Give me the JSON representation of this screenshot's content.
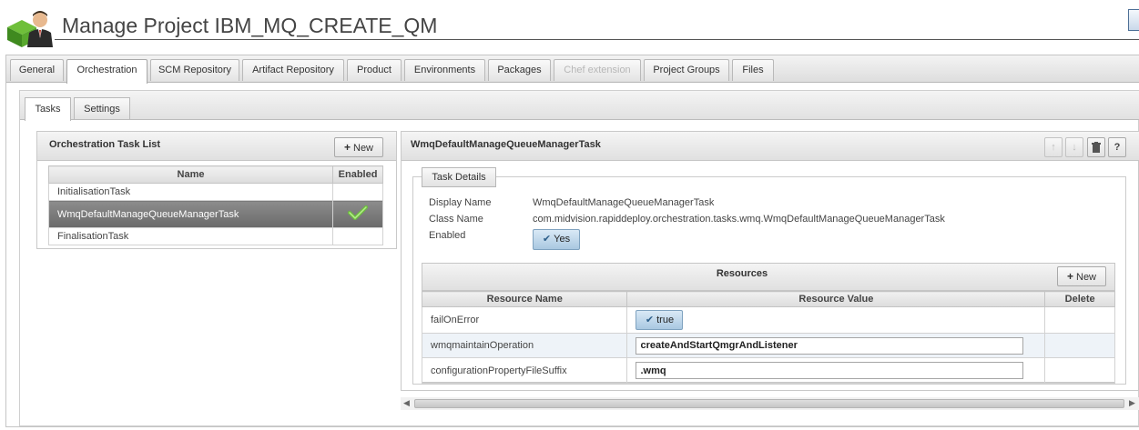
{
  "header": {
    "title": "Manage Project IBM_MQ_CREATE_QM"
  },
  "main_tabs": [
    {
      "label": "General"
    },
    {
      "label": "Orchestration"
    },
    {
      "label": "SCM Repository"
    },
    {
      "label": "Artifact Repository"
    },
    {
      "label": "Product"
    },
    {
      "label": "Environments"
    },
    {
      "label": "Packages"
    },
    {
      "label": "Chef extension"
    },
    {
      "label": "Project Groups"
    },
    {
      "label": "Files"
    }
  ],
  "sub_tabs": [
    {
      "label": "Tasks"
    },
    {
      "label": "Settings"
    }
  ],
  "task_list": {
    "title": "Orchestration Task List",
    "new_label": "New",
    "columns": [
      "Name",
      "Enabled"
    ],
    "rows": [
      {
        "name": "InitialisationTask"
      },
      {
        "name": "WmqDefaultManageQueueManagerTask"
      },
      {
        "name": "FinalisationTask"
      }
    ]
  },
  "detail": {
    "title": "WmqDefaultManageQueueManagerTask",
    "section_label": "Task Details",
    "display_name_label": "Display Name",
    "display_name_value": "WmqDefaultManageQueueManagerTask",
    "class_name_label": "Class Name",
    "class_name_value": "com.midvision.rapiddeploy.orchestration.tasks.wmq.WmqDefaultManageQueueManagerTask",
    "enabled_label": "Enabled",
    "enabled_value": "Yes"
  },
  "resources": {
    "title": "Resources",
    "new_label": "New",
    "columns": [
      "Resource Name",
      "Resource Value",
      "Delete"
    ],
    "rows": [
      {
        "name": "failOnError",
        "value": "true"
      },
      {
        "name": "wmqmaintainOperation",
        "value": "createAndStartQmgrAndListener"
      },
      {
        "name": "configurationPropertyFileSuffix",
        "value": ".wmq"
      }
    ]
  },
  "colors": {
    "accent": "#a9c8e1",
    "selected_row": "#7a7a7a",
    "check": "#6cbf3c"
  }
}
